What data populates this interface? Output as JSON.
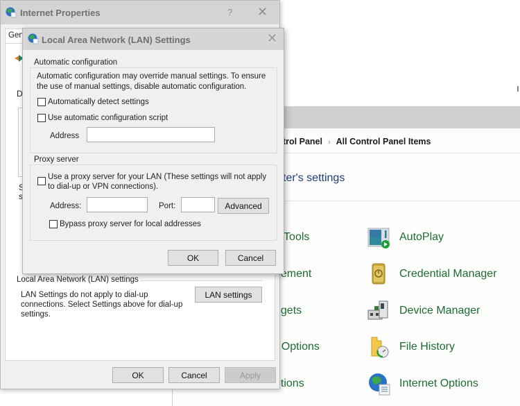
{
  "control_panel": {
    "breadcrumb": [
      "trol Panel",
      "All Control Panel Items"
    ],
    "breadcrumb_separator": "›",
    "heading": "ter's settings",
    "left_column_items": [
      "e Tools",
      "gement",
      "dgets",
      "r Options",
      "ptions"
    ],
    "right_column_items": [
      {
        "label": "AutoPlay",
        "icon": "autoplay-icon"
      },
      {
        "label": "Credential Manager",
        "icon": "credential-manager-icon"
      },
      {
        "label": "Device Manager",
        "icon": "device-manager-icon"
      },
      {
        "label": "File History",
        "icon": "file-history-icon"
      },
      {
        "label": "Internet Options",
        "icon": "internet-options-icon"
      }
    ],
    "colors": {
      "link_green": "#1d6b34",
      "heading_blue": "#1e3d78"
    }
  },
  "internet_properties": {
    "title": "Internet Properties",
    "help_label": "?",
    "close_label": "✕",
    "tab_label": "Gen",
    "partial_labels": {
      "di": "Di",
      "s1": "S",
      "s2": "s"
    },
    "lan_group_label": "Local Area Network (LAN) settings",
    "lan_description": "LAN Settings do not apply to dial-up connections. Select Settings above for dial-up settings.",
    "lan_settings_button": "LAN settings",
    "ok_button": "OK",
    "cancel_button": "Cancel",
    "apply_button": "Apply"
  },
  "lan_settings": {
    "title": "Local Area Network (LAN) Settings",
    "close_label": "✕",
    "auto_config": {
      "group_label": "Automatic configuration",
      "description_line1": "Automatic configuration may override manual settings.  To ensure",
      "description_line2": "the use of manual settings, disable automatic configuration.",
      "auto_detect_label": "Automatically detect settings",
      "auto_detect_checked": false,
      "use_script_label": "Use automatic configuration script",
      "use_script_checked": false,
      "address_label": "Address",
      "address_value": ""
    },
    "proxy": {
      "group_label": "Proxy server",
      "use_proxy_line1": "Use a proxy server for your LAN (These settings will not apply",
      "use_proxy_line2": "to dial-up or VPN connections).",
      "use_proxy_checked": false,
      "address_label": "Address:",
      "address_value": "",
      "port_label": "Port:",
      "port_value": "",
      "advanced_button": "Advanced",
      "bypass_label": "Bypass proxy server for local addresses",
      "bypass_checked": false
    },
    "ok_button": "OK",
    "cancel_button": "Cancel"
  }
}
